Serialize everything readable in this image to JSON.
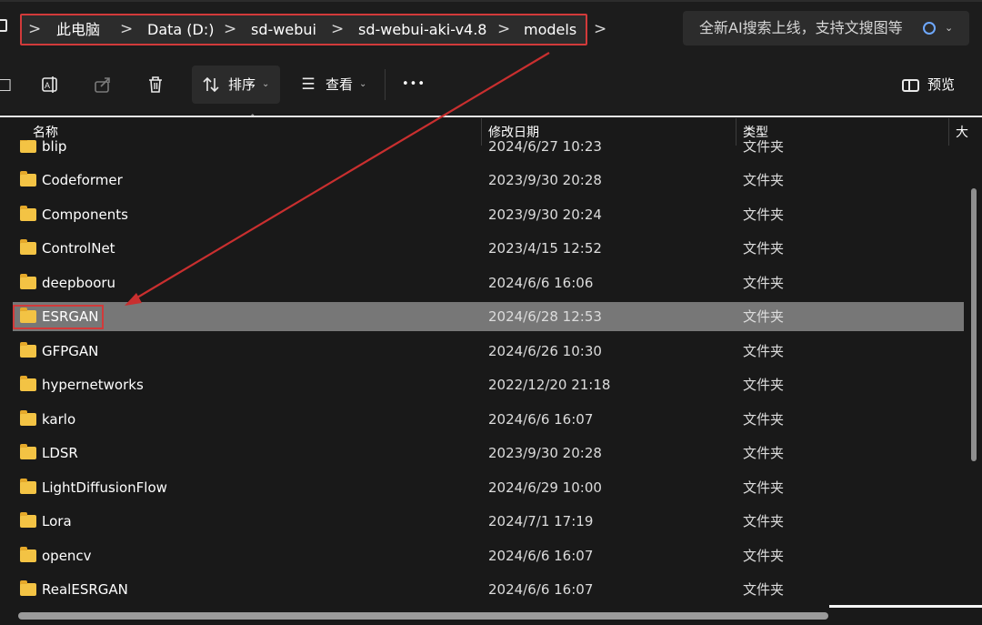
{
  "breadcrumb": {
    "items": [
      "此电脑",
      "Data (D:)",
      "sd-webui",
      "sd-webui-aki-v4.8",
      "models"
    ],
    "separator": ">"
  },
  "search": {
    "placeholder": "全新AI搜索上线，支持文搜图等"
  },
  "toolbar": {
    "sort_label": "排序",
    "view_label": "查看",
    "more_label": "•••",
    "preview_label": "预览"
  },
  "columns": {
    "name": "名称",
    "date": "修改日期",
    "type": "类型",
    "size": "大"
  },
  "rows": [
    {
      "name": "blip",
      "date": "2024/6/27 10:23",
      "type": "文件夹"
    },
    {
      "name": "Codeformer",
      "date": "2023/9/30 20:28",
      "type": "文件夹"
    },
    {
      "name": "Components",
      "date": "2023/9/30 20:24",
      "type": "文件夹"
    },
    {
      "name": "ControlNet",
      "date": "2023/4/15 12:52",
      "type": "文件夹"
    },
    {
      "name": "deepbooru",
      "date": "2024/6/6 16:06",
      "type": "文件夹"
    },
    {
      "name": "ESRGAN",
      "date": "2024/6/28 12:53",
      "type": "文件夹"
    },
    {
      "name": "GFPGAN",
      "date": "2024/6/26 10:30",
      "type": "文件夹"
    },
    {
      "name": "hypernetworks",
      "date": "2022/12/20 21:18",
      "type": "文件夹"
    },
    {
      "name": "karlo",
      "date": "2024/6/6 16:07",
      "type": "文件夹"
    },
    {
      "name": "LDSR",
      "date": "2023/9/30 20:28",
      "type": "文件夹"
    },
    {
      "name": "LightDiffusionFlow",
      "date": "2024/6/29 10:00",
      "type": "文件夹"
    },
    {
      "name": "Lora",
      "date": "2024/7/1 17:19",
      "type": "文件夹"
    },
    {
      "name": "opencv",
      "date": "2024/6/6 16:07",
      "type": "文件夹"
    },
    {
      "name": "RealESRGAN",
      "date": "2024/6/6 16:07",
      "type": "文件夹"
    }
  ],
  "selected_row": "ESRGAN",
  "colors": {
    "background": "#191919",
    "selection": "#777777",
    "annotation": "#d23a3a",
    "folder": "#f3c344"
  }
}
